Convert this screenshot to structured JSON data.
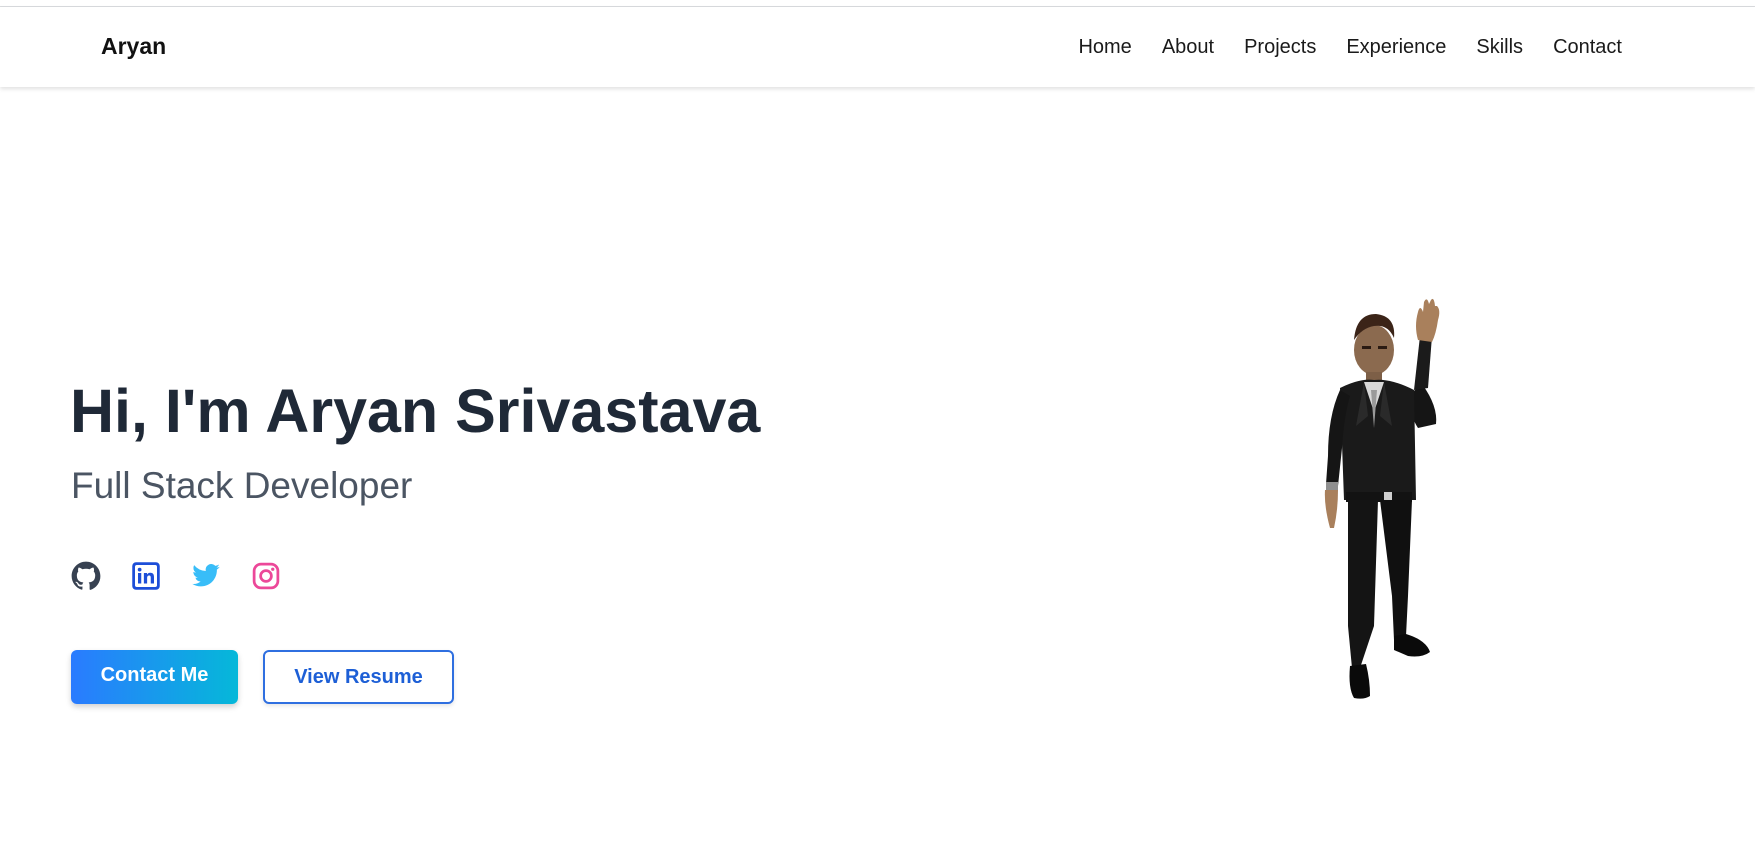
{
  "nav": {
    "brand": "Aryan",
    "links": [
      "Home",
      "About",
      "Projects",
      "Experience",
      "Skills",
      "Contact"
    ]
  },
  "hero": {
    "title": "Hi, I'm Aryan Srivastava",
    "subtitle": "Full Stack Developer",
    "socials": [
      {
        "icon": "github-icon",
        "color": "#374151"
      },
      {
        "icon": "linkedin-icon",
        "color": "#1d4ed8"
      },
      {
        "icon": "twitter-icon",
        "color": "#38bdf8"
      },
      {
        "icon": "instagram-icon",
        "color": "#ec4899"
      }
    ],
    "primary_button": "Contact Me",
    "secondary_button": "View Resume"
  },
  "colors": {
    "accent_blue": "#2a7bff",
    "accent_cyan": "#05b8d9",
    "title": "#1f2937",
    "subtitle": "#4b5563"
  }
}
